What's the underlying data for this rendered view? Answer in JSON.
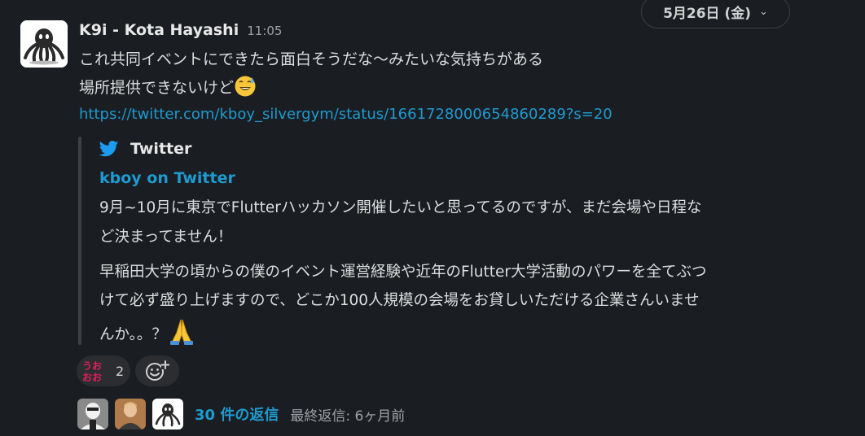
{
  "date_divider": {
    "label": "5月26日 (金)",
    "chevron_icon": "chevron-down-icon"
  },
  "message": {
    "sender": "K9i - Kota Hayashi",
    "time": "11:05",
    "lines": [
      "これ共同イベントにできたら面白そうだな〜みたいな気持ちがある",
      "場所提供できないけど"
    ],
    "emoji_line2": "sweat-smile-emoji",
    "link": "https://twitter.com/kboy_silvergym/status/1661728000654860289?s=20"
  },
  "unfurl": {
    "source_icon": "twitter-bird-icon",
    "source": "Twitter",
    "title": "kboy on Twitter",
    "body_lines": [
      "9月~10月に東京でFlutterハッカソン開催したいと思ってるのですが、まだ会場や日程な",
      "ど決まってません！",
      "早稲田大学の頃からの僕のイベント運営経験や近年のFlutter大学活動のパワーを全てぶつ",
      "けて必ず盛り上げますので、どこか100人規模の会場をお貸しいただける企業さんいませ",
      "んか。。？"
    ],
    "end_emoji": "folded-hands-emoji"
  },
  "reactions": [
    {
      "emoji_text": "うおおお",
      "count": "2"
    }
  ],
  "add_reaction_icon": "add-reaction-icon",
  "thread": {
    "count_label": "30 件の返信",
    "last_reply": "最終返信: 6ヶ月前"
  },
  "colors": {
    "background": "#1a1d21",
    "link": "#1d9bd1",
    "twitter_blue": "#1d9bf0",
    "reaction_red": "#e01e5a"
  }
}
